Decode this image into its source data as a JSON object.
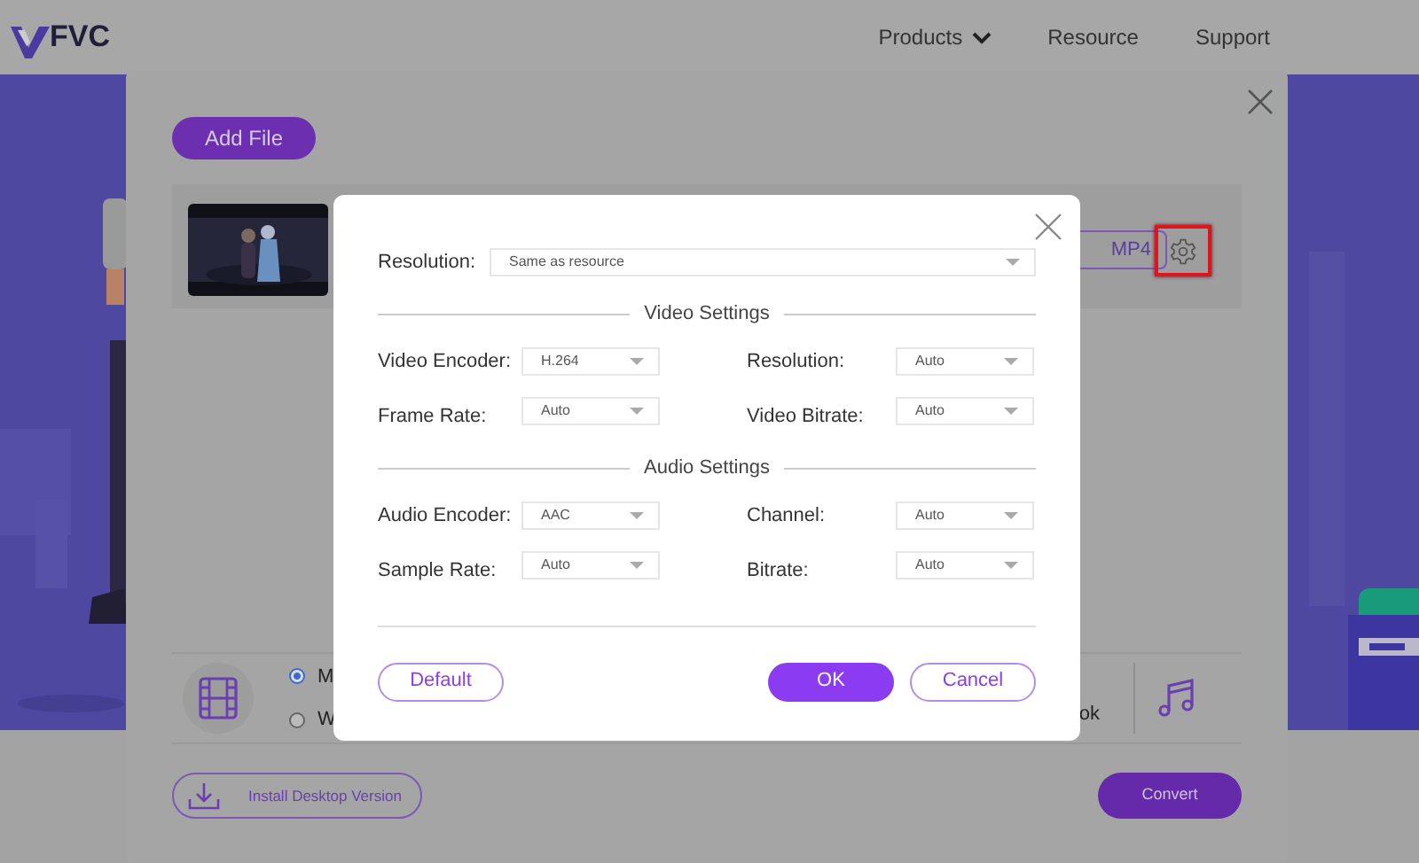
{
  "header": {
    "logo": "FVC",
    "nav": [
      {
        "label": "Products",
        "dropdown": true
      },
      {
        "label": "Resource",
        "dropdown": false
      },
      {
        "label": "Support",
        "dropdown": false
      }
    ]
  },
  "converter": {
    "add_file": "Add File",
    "file": {
      "format": "MP4",
      "settings_highlighted": true
    },
    "formats": [
      {
        "label": "M",
        "selected": true
      },
      {
        "label": "W",
        "selected": false
      }
    ],
    "format_text": "ok",
    "install": "Install Desktop Version",
    "convert": "Convert"
  },
  "settings_dialog": {
    "resolution": {
      "label": "Resolution:",
      "value": "Same as resource"
    },
    "sections": [
      {
        "title": "Video Settings",
        "fields": [
          {
            "label": "Video Encoder:",
            "value": "H.264"
          },
          {
            "label": "Resolution:",
            "value": "Auto"
          },
          {
            "label": "Frame Rate:",
            "value": "Auto"
          },
          {
            "label": "Video Bitrate:",
            "value": "Auto"
          }
        ]
      },
      {
        "title": "Audio Settings",
        "fields": [
          {
            "label": "Audio Encoder:",
            "value": "AAC"
          },
          {
            "label": "Channel:",
            "value": "Auto"
          },
          {
            "label": "Sample Rate:",
            "value": "Auto"
          },
          {
            "label": "Bitrate:",
            "value": "Auto"
          }
        ]
      }
    ],
    "buttons": [
      {
        "label": "Default",
        "kind": "secondary"
      },
      {
        "label": "OK",
        "kind": "primary"
      },
      {
        "label": "Cancel",
        "kind": "secondary"
      }
    ]
  }
}
